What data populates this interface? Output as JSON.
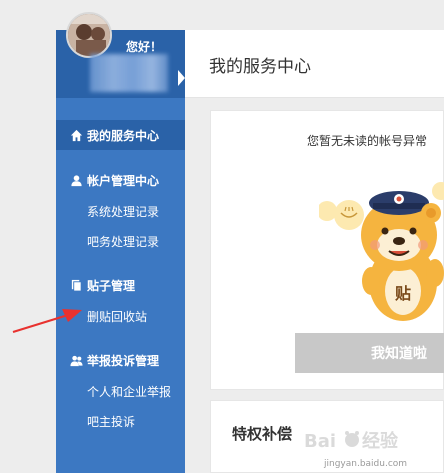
{
  "sidebar": {
    "greeting": "您好！",
    "sections": [
      {
        "label": "我的服务中心",
        "icon": "home-icon",
        "active": true
      },
      {
        "label": "帐户管理中心",
        "icon": "user-icon",
        "items": [
          "系统处理记录",
          "吧务处理记录"
        ]
      },
      {
        "label": "贴子管理",
        "icon": "document-icon",
        "items": [
          "删贴回收站"
        ]
      },
      {
        "label": "举报投诉管理",
        "icon": "users-icon",
        "items": [
          "个人和企业举报",
          "吧主投诉"
        ]
      }
    ]
  },
  "main": {
    "title": "我的服务中心",
    "notice": "您暂无未读的帐号异常",
    "ack_button": "我知道啦",
    "privilege_title": "特权补偿"
  },
  "watermark": {
    "logo_text": "Baidu 经验",
    "url": "jingyan.baidu.com"
  },
  "colors": {
    "sidebar": "#3c78c2",
    "sidebar_dark": "#2a62a8",
    "button_disabled": "#c8c8c8",
    "arrow": "#e8322f"
  }
}
